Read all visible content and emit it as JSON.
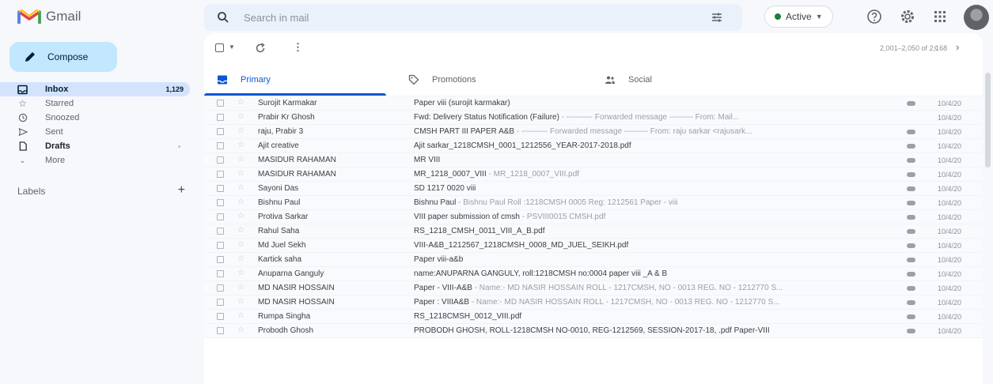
{
  "app": {
    "name": "Gmail",
    "accent": "#0b57d0",
    "compose_bg": "#c2e7ff"
  },
  "header": {
    "search_placeholder": "Search in mail",
    "status_label": "Active",
    "status_color": "#188038"
  },
  "sidebar": {
    "compose_label": "Compose",
    "items": [
      {
        "label": "Inbox",
        "count": "1,129",
        "icon": "inbox-icon",
        "selected": true
      },
      {
        "label": "Starred",
        "count": "",
        "icon": "star-icon"
      },
      {
        "label": "Snoozed",
        "count": "",
        "icon": "clock-icon"
      },
      {
        "label": "Sent",
        "count": "",
        "icon": "send-icon"
      },
      {
        "label": "Drafts",
        "count": "",
        "icon": "draft-icon"
      },
      {
        "label": "More",
        "count": "",
        "icon": "chevron-down-icon"
      }
    ],
    "labels_heading": "Labels"
  },
  "toolbar": {
    "pagination": "2,001–2,050 of 2,168"
  },
  "tabs": [
    {
      "label": "Primary",
      "icon": "inbox-icon",
      "active": true
    },
    {
      "label": "Promotions",
      "icon": "tag-icon"
    },
    {
      "label": "Social",
      "icon": "people-icon"
    }
  ],
  "emails": [
    {
      "sender": "Surojit Karmakar",
      "subject": "Paper viii (surojit karmakar)",
      "snippet": "",
      "time": "10/4/20",
      "attachment": true
    },
    {
      "sender": "Prabir Kr Ghosh",
      "subject": "Fwd: Delivery Status Notification (Failure)",
      "snippet": " - ---------- Forwarded message --------- From: Mail...",
      "time": "10/4/20",
      "attachment": false
    },
    {
      "sender": "raju, Prabir 3",
      "subject": "CMSH PART III PAPER A&B",
      "snippet": " - ---------- Forwarded message --------- From: raju sarkar <rajusark...",
      "time": "10/4/20",
      "attachment": true
    },
    {
      "sender": "Ajit creative",
      "subject": "Ajit sarkar_1218CMSH_0001_1212556_YEAR-2017-2018.pdf",
      "snippet": "",
      "time": "10/4/20",
      "attachment": true
    },
    {
      "sender": "MASIDUR RAHAMAN",
      "subject": "MR VIII",
      "snippet": "",
      "time": "10/4/20",
      "attachment": true
    },
    {
      "sender": "MASIDUR RAHAMAN",
      "subject": "MR_1218_0007_VIII",
      "snippet": " - MR_1218_0007_VIII.pdf",
      "time": "10/4/20",
      "attachment": true
    },
    {
      "sender": "Sayoni Das",
      "subject": "SD 1217 0020 viii",
      "snippet": "",
      "time": "10/4/20",
      "attachment": true
    },
    {
      "sender": "Bishnu Paul",
      "subject": "Bishnu Paul",
      "snippet": " - Bishnu Paul Roll :1218CMSH 0005 Reg: 1212561 Paper - viii",
      "time": "10/4/20",
      "attachment": true
    },
    {
      "sender": "Protiva Sarkar",
      "subject": "VIII paper submission of cmsh",
      "snippet": " - PSVIII0015 CMSH.pdf",
      "time": "10/4/20",
      "attachment": true
    },
    {
      "sender": "Rahul Saha",
      "subject": "RS_1218_CMSH_0011_VIII_A_B.pdf",
      "snippet": "",
      "time": "10/4/20",
      "attachment": true
    },
    {
      "sender": "Md Juel Sekh",
      "subject": "VIII-A&B_1212567_1218CMSH_0008_MD_JUEL_SEIKH.pdf",
      "snippet": "",
      "time": "10/4/20",
      "attachment": true
    },
    {
      "sender": "Kartick saha",
      "subject": "Paper viii-a&b",
      "snippet": "",
      "time": "10/4/20",
      "attachment": true
    },
    {
      "sender": "Anuparna Ganguly",
      "subject": "name:ANUPARNA GANGULY, roll:1218CMSH no:0004 paper viii _A & B",
      "snippet": "",
      "time": "10/4/20",
      "attachment": true
    },
    {
      "sender": "MD NASIR HOSSAIN",
      "subject": "Paper - VIII-A&B",
      "snippet": " - Name:- MD NASIR HOSSAIN ROLL - 1217CMSH, NO - 0013 REG. NO - 1212770 S...",
      "time": "10/4/20",
      "attachment": true
    },
    {
      "sender": "MD NASIR HOSSAIN",
      "subject": "Paper : VIIIA&B",
      "snippet": " - Name:- MD NASIR HOSSAIN ROLL - 1217CMSH, NO - 0013 REG. NO - 1212770 S...",
      "time": "10/4/20",
      "attachment": true
    },
    {
      "sender": "Rumpa Singha",
      "subject": "RS_1218CMSH_0012_VIII.pdf",
      "snippet": "",
      "time": "10/4/20",
      "attachment": true
    },
    {
      "sender": "Probodh Ghosh",
      "subject": "PROBODH GHOSH, ROLL-1218CMSH NO-0010, REG-1212569, SESSION-2017-18, .pdf Paper-VIII",
      "snippet": "",
      "time": "10/4/20",
      "attachment": true
    }
  ]
}
